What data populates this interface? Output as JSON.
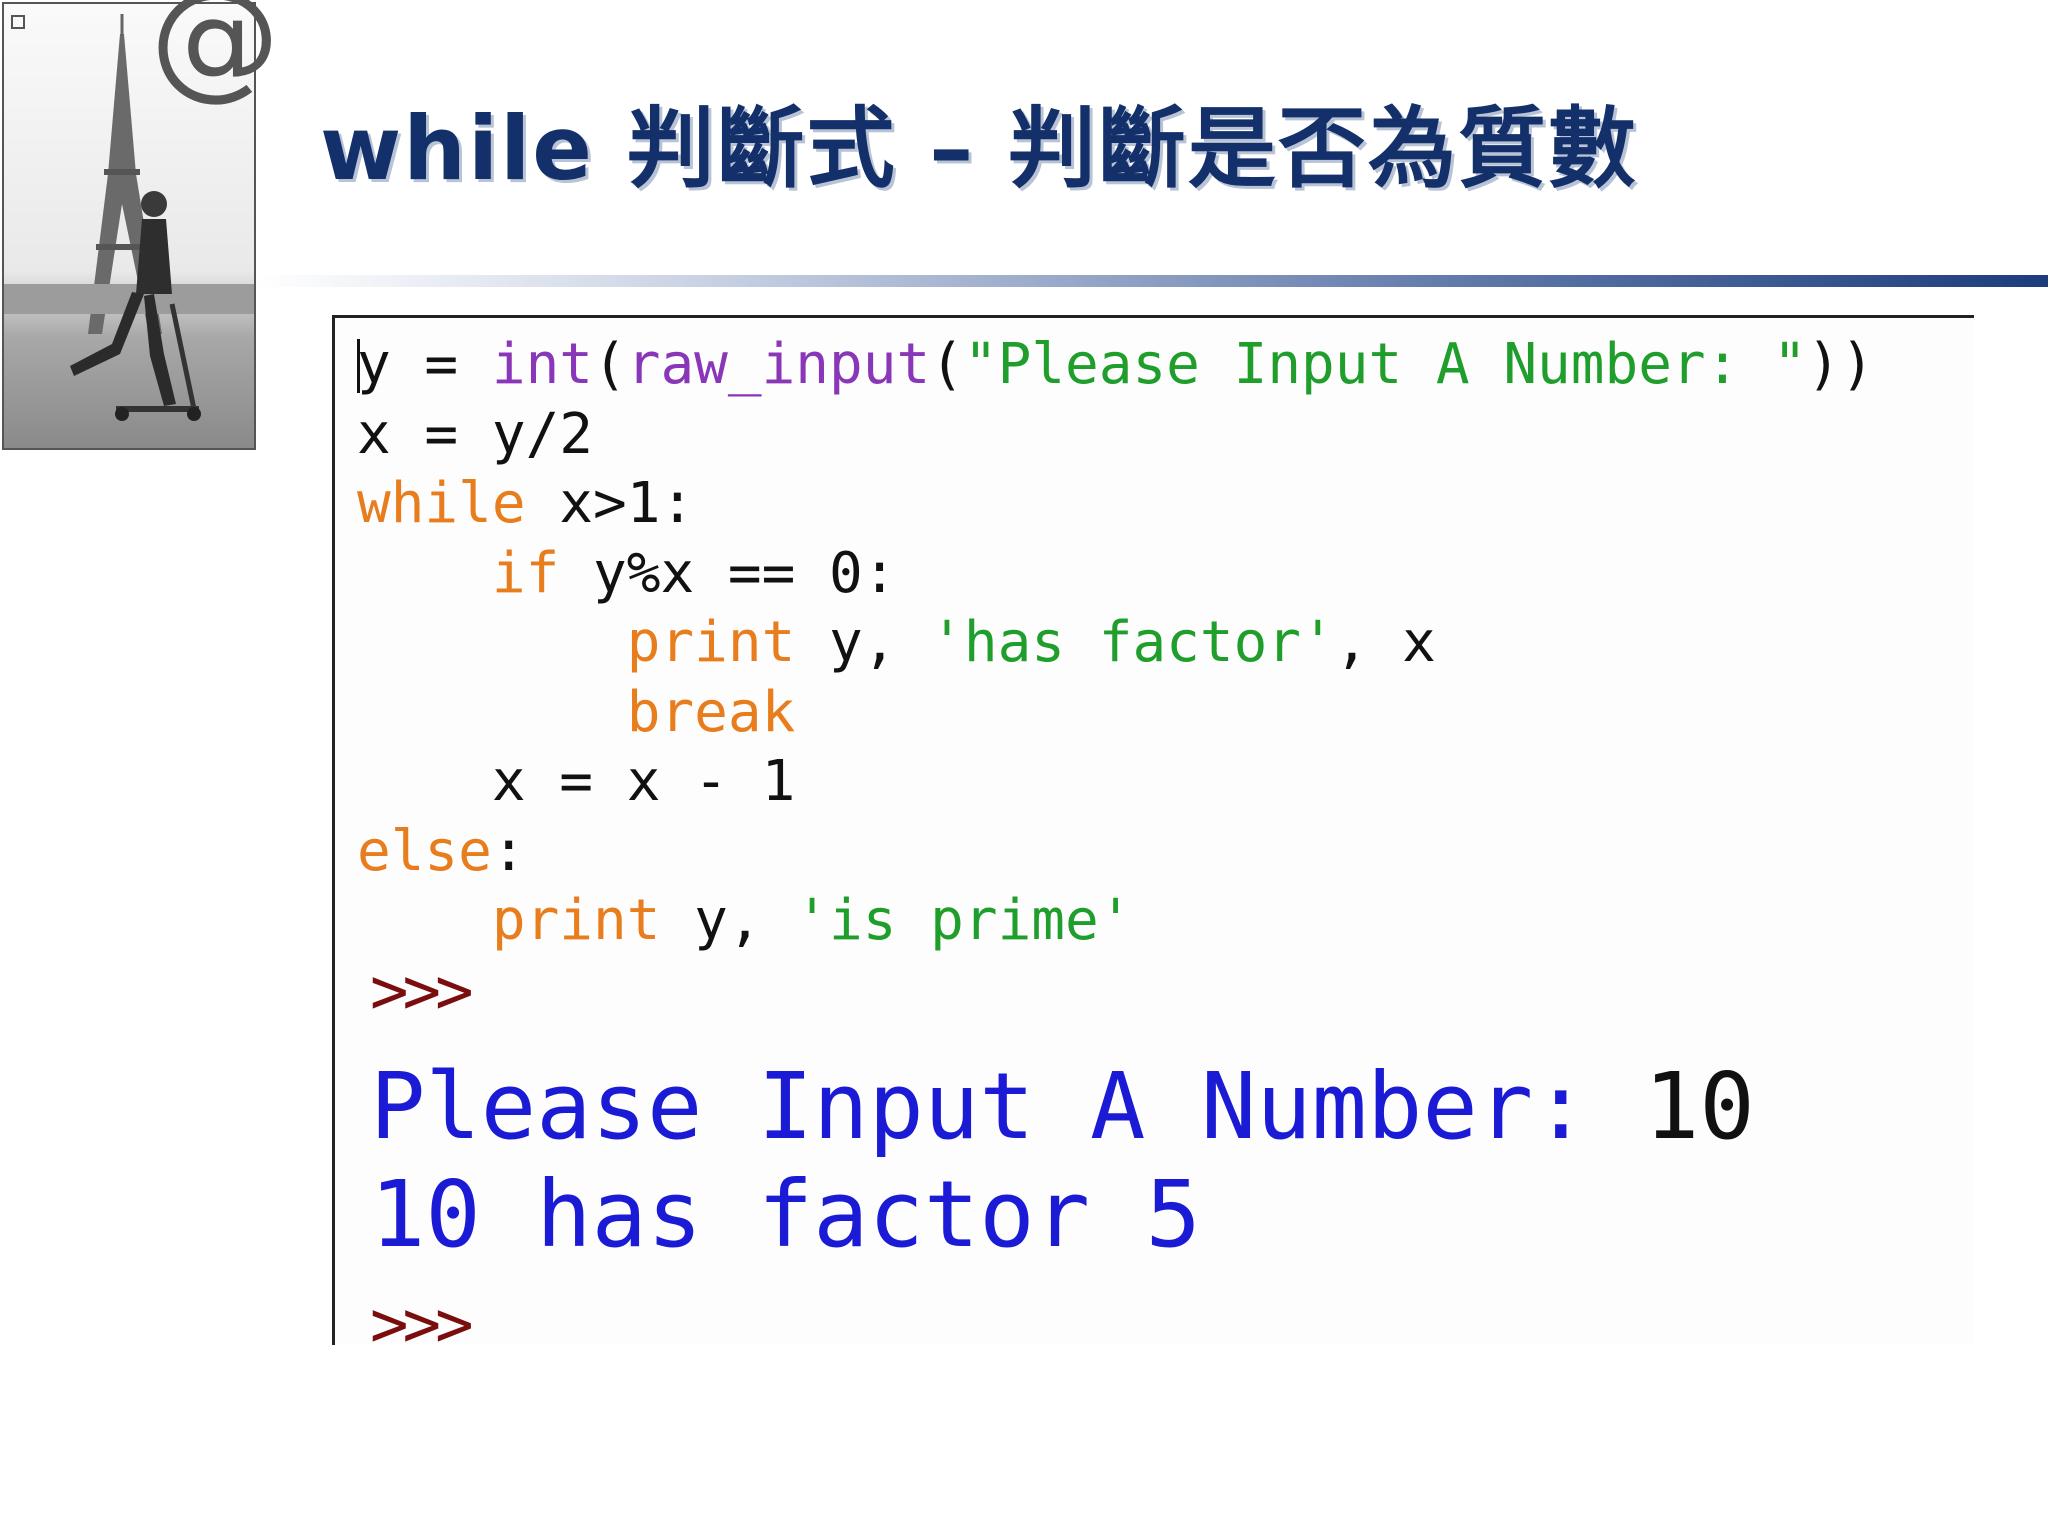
{
  "slide": {
    "title": "while 判斷式 – 判斷是否為質數"
  },
  "photo": {
    "at_symbol": "@"
  },
  "code": {
    "lines": [
      [
        {
          "t": "y = ",
          "c": ""
        },
        {
          "t": "int",
          "c": "bi"
        },
        {
          "t": "(",
          "c": ""
        },
        {
          "t": "raw_input",
          "c": "bi"
        },
        {
          "t": "(",
          "c": ""
        },
        {
          "t": "\"Please Input A Number: \"",
          "c": "st"
        },
        {
          "t": "))",
          "c": ""
        }
      ],
      [
        {
          "t": "x = y/2",
          "c": ""
        }
      ],
      [
        {
          "t": "while",
          "c": "kw"
        },
        {
          "t": " x>1:",
          "c": ""
        }
      ],
      [
        {
          "t": "    ",
          "c": ""
        },
        {
          "t": "if",
          "c": "kw"
        },
        {
          "t": " y%x == 0:",
          "c": ""
        }
      ],
      [
        {
          "t": "        ",
          "c": ""
        },
        {
          "t": "print",
          "c": "kw"
        },
        {
          "t": " y, ",
          "c": ""
        },
        {
          "t": "'has factor'",
          "c": "st"
        },
        {
          "t": ", x",
          "c": ""
        }
      ],
      [
        {
          "t": "        ",
          "c": ""
        },
        {
          "t": "break",
          "c": "kw"
        }
      ],
      [
        {
          "t": "    x = x - 1",
          "c": ""
        }
      ],
      [
        {
          "t": "else",
          "c": "kw"
        },
        {
          "t": ":",
          "c": ""
        }
      ],
      [
        {
          "t": "    ",
          "c": ""
        },
        {
          "t": "print",
          "c": "kw"
        },
        {
          "t": " y, ",
          "c": ""
        },
        {
          "t": "'is prime'",
          "c": "st"
        }
      ]
    ]
  },
  "shell": {
    "prompt": ">>>",
    "prompt_label": "Please Input A Number: ",
    "input_value": "10",
    "result_line": "10 has factor 5"
  },
  "colors": {
    "keyword": "#e87d1e",
    "builtin": "#8a36b8",
    "string": "#1f9e2c",
    "prompt": "#7a0e0e",
    "output": "#1b1bd6",
    "title": "#14306a"
  }
}
